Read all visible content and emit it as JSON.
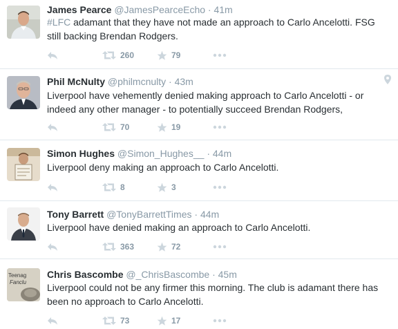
{
  "tweets": [
    {
      "fullname": "James Pearce",
      "username": "@JamesPearceEcho",
      "time": "41m",
      "hashtag": "#LFC",
      "text": " adamant that they have not made an approach to Carlo Ancelotti. FSG still backing Brendan Rodgers.",
      "retweets": "260",
      "favorites": "79"
    },
    {
      "fullname": "Phil McNulty",
      "username": "@philmcnulty",
      "time": "43m",
      "text": "Liverpool have vehemently denied making approach to Carlo Ancelotti - or indeed any other manager - to potentially succeed Brendan Rodgers,",
      "retweets": "70",
      "favorites": "19"
    },
    {
      "fullname": "Simon Hughes",
      "username": "@Simon_Hughes__",
      "time": "44m",
      "text": "Liverpool deny making an approach to Carlo Ancelotti.",
      "retweets": "8",
      "favorites": "3"
    },
    {
      "fullname": "Tony Barrett",
      "username": "@TonyBarrettTimes",
      "time": "44m",
      "text": "Liverpool have denied making an approach to Carlo Ancelotti.",
      "retweets": "363",
      "favorites": "72"
    },
    {
      "fullname": "Chris Bascombe",
      "username": "@_ChrisBascombe",
      "time": "45m",
      "text": "Liverpool could not be any firmer this morning. The club is adamant there has been no approach to Carlo Ancelotti.",
      "retweets": "73",
      "favorites": "17",
      "avatar_text_top": "Teenag",
      "avatar_text_mid": "Fanclu"
    }
  ],
  "separator": "·",
  "colors": {
    "text": "#292f33",
    "muted": "#8899a6",
    "icon": "#ccd6dd",
    "divider": "#e1e8ed"
  },
  "icons": {
    "reply": "reply-arrow-icon",
    "retweet": "retweet-icon",
    "favorite": "star-icon",
    "more": "more-dots-icon",
    "location": "location-pin-icon"
  }
}
